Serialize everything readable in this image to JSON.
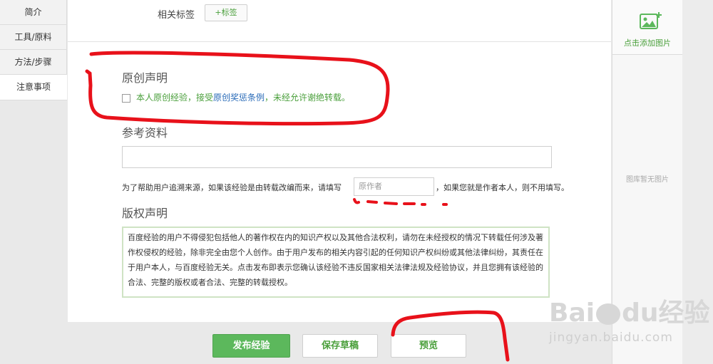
{
  "left_nav": {
    "items": [
      {
        "label": "简介",
        "active": false
      },
      {
        "label": "工具/原料",
        "active": false
      },
      {
        "label": "方法/步骤",
        "active": false
      },
      {
        "label": "注意事项",
        "active": true
      }
    ]
  },
  "tags": {
    "label": "相关标签",
    "add_button": "+标签"
  },
  "original": {
    "title": "原创声明",
    "checked": false,
    "text_before": "本人原创经验，接受",
    "link_text": "原创奖惩条例",
    "text_after": "，未经允许谢绝转载。"
  },
  "reference": {
    "title": "参考资料",
    "value": "",
    "help_before": "为了帮助用户追溯来源，如果该经验是由转载改编而来，请填写",
    "author_placeholder": "原作者",
    "help_after": "，如果您就是作者本人，则不用填写。"
  },
  "copyright": {
    "title": "版权声明",
    "text": "百度经验的用户不得侵犯包括他人的著作权在内的知识产权以及其他合法权利，请勿在未经授权的情况下转载任何涉及著作权侵权的经验，除非完全由您个人创作。由于用户发布的相关内容引起的任何知识产权纠纷或其他法律纠纷，其责任在于用户本人，与百度经验无关。点击发布即表示您确认该经验不违反国家相关法律法规及经验协议，并且您拥有该经验的合法、完整的版权或者合法、完整的转载授权。"
  },
  "buttons": {
    "publish": "发布经验",
    "save_draft": "保存草稿",
    "preview": "预览"
  },
  "side_panel": {
    "add_image": "点击添加图片",
    "empty_gallery": "图库暂无图片"
  },
  "watermark": {
    "brand": "Bai",
    "brand_suffix": "经验",
    "domain": "jingyan.baidu.com"
  },
  "colors": {
    "accent_green": "#4a9f3b",
    "button_green": "#5cb85c",
    "link_blue": "#2a6bb8",
    "annotation_red": "#e8111a"
  }
}
